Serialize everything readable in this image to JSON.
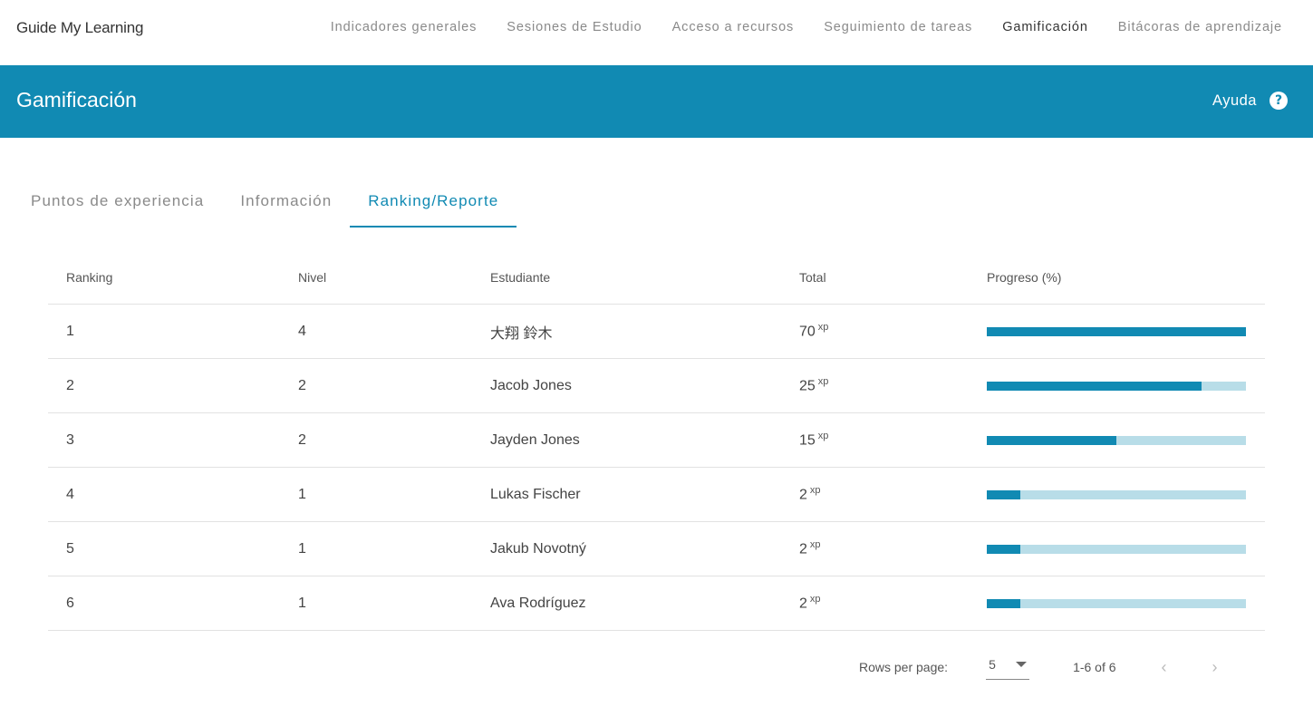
{
  "nav": {
    "brand": "Guide My Learning",
    "links": [
      {
        "label": "Indicadores generales",
        "active": false
      },
      {
        "label": "Sesiones de Estudio",
        "active": false
      },
      {
        "label": "Acceso a recursos",
        "active": false
      },
      {
        "label": "Seguimiento de tareas",
        "active": false
      },
      {
        "label": "Gamificación",
        "active": true
      },
      {
        "label": "Bitácoras de aprendizaje",
        "active": false
      }
    ]
  },
  "header": {
    "title": "Gamificación",
    "help_label": "Ayuda",
    "help_icon": "?"
  },
  "tabs": [
    {
      "label": "Puntos de experiencia",
      "active": false
    },
    {
      "label": "Información",
      "active": false
    },
    {
      "label": "Ranking/Reporte",
      "active": true
    }
  ],
  "table": {
    "columns": [
      "Ranking",
      "Nivel",
      "Estudiante",
      "Total",
      "Progreso (%)"
    ],
    "xp_unit": "xp",
    "rows": [
      {
        "ranking": "1",
        "nivel": "4",
        "estudiante": "大翔 鈴木",
        "total": "70",
        "progress_pct": 100
      },
      {
        "ranking": "2",
        "nivel": "2",
        "estudiante": "Jacob Jones",
        "total": "25",
        "progress_pct": 83
      },
      {
        "ranking": "3",
        "nivel": "2",
        "estudiante": "Jayden Jones",
        "total": "15",
        "progress_pct": 50
      },
      {
        "ranking": "4",
        "nivel": "1",
        "estudiante": "Lukas Fischer",
        "total": "2",
        "progress_pct": 13
      },
      {
        "ranking": "5",
        "nivel": "1",
        "estudiante": "Jakub Novotný",
        "total": "2",
        "progress_pct": 13
      },
      {
        "ranking": "6",
        "nivel": "1",
        "estudiante": "Ava Rodríguez",
        "total": "2",
        "progress_pct": 13
      }
    ]
  },
  "pagination": {
    "rows_per_page_label": "Rows per page:",
    "rows_per_page_value": "5",
    "range": "1-6 of 6",
    "prev_icon": "‹",
    "next_icon": "›"
  },
  "colors": {
    "accent": "#118ab3",
    "progress_track": "#b8dde8"
  }
}
